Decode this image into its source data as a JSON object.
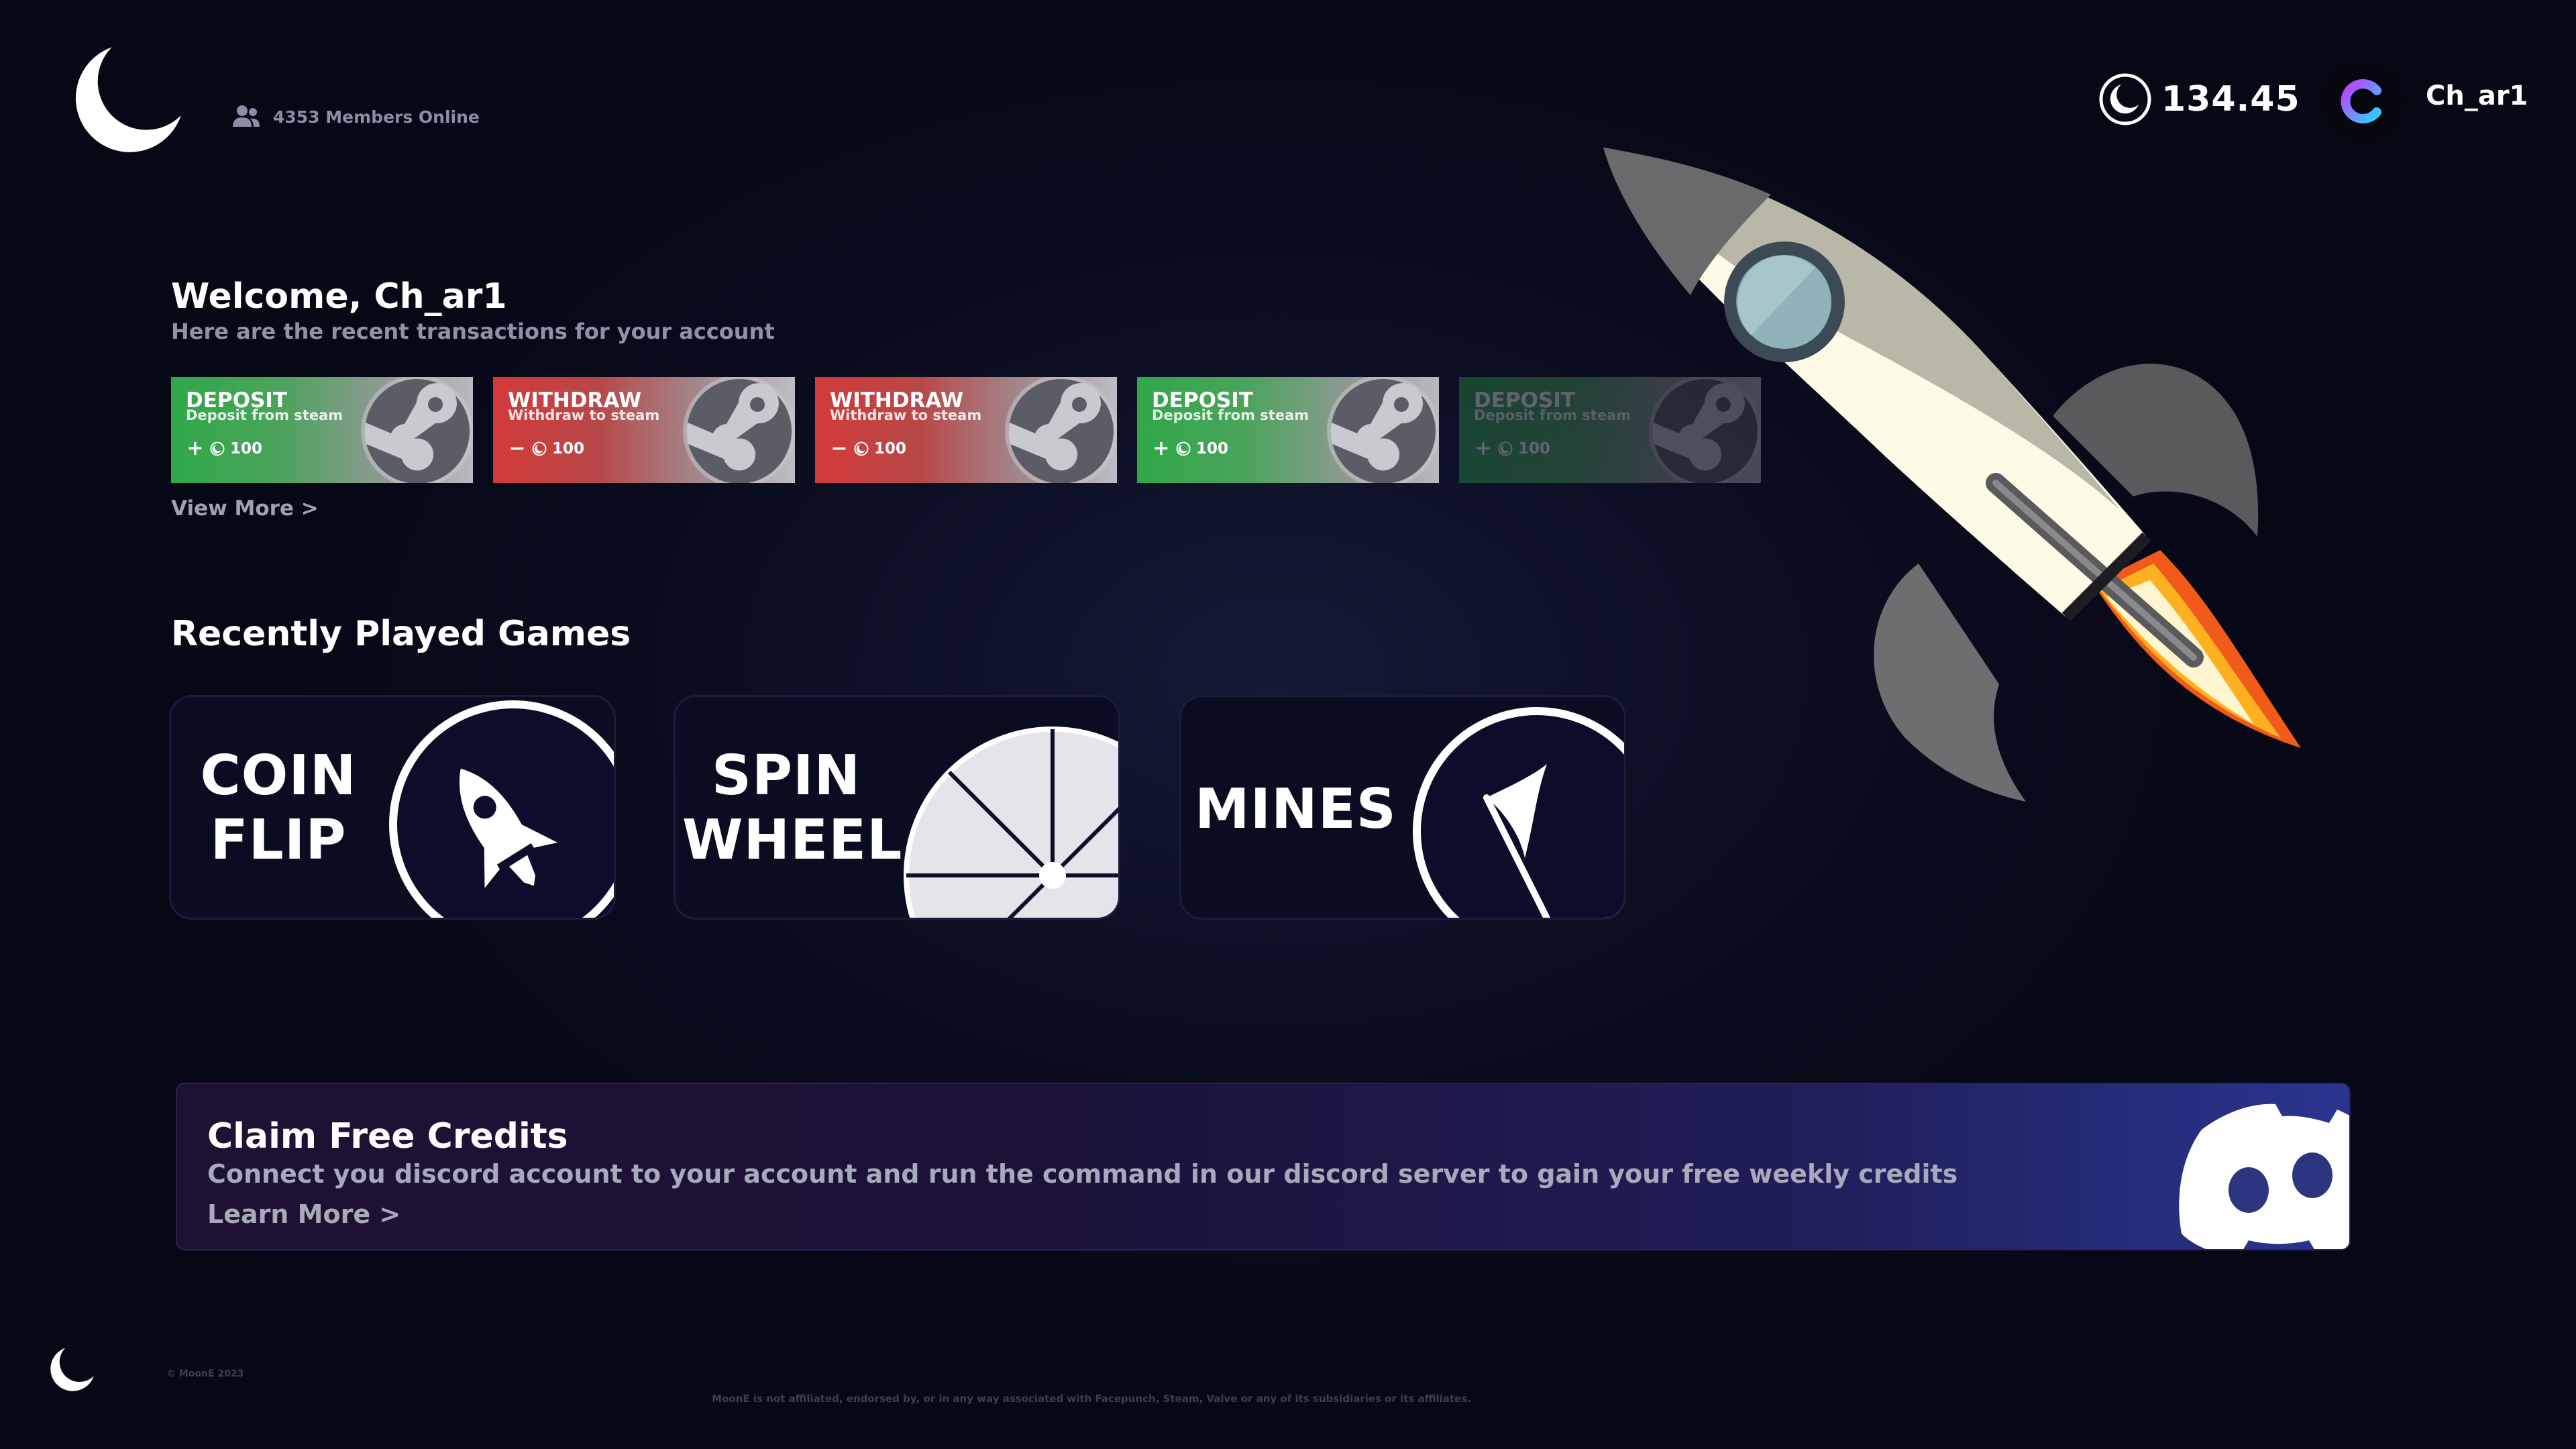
{
  "header": {
    "members_online": "4353 Members Online",
    "balance": "134.45",
    "username": "Ch_ar1"
  },
  "welcome": {
    "title": "Welcome, Ch_ar1",
    "subtitle": "Here are the recent transactions for your account"
  },
  "transactions": [
    {
      "type": "DEPOSIT",
      "description": "Deposit from steam",
      "sign": "+",
      "amount": "100",
      "kind": "deposit"
    },
    {
      "type": "WITHDRAW",
      "description": "Withdraw to steam",
      "sign": "−",
      "amount": "100",
      "kind": "withdraw"
    },
    {
      "type": "WITHDRAW",
      "description": "Withdraw to steam",
      "sign": "−",
      "amount": "100",
      "kind": "withdraw"
    },
    {
      "type": "DEPOSIT",
      "description": "Deposit from steam",
      "sign": "+",
      "amount": "100",
      "kind": "deposit"
    },
    {
      "type": "DEPOSIT",
      "description": "Deposit from steam",
      "sign": "+",
      "amount": "100",
      "kind": "deposit"
    }
  ],
  "view_more": "View More >",
  "games": {
    "title": "Recently Played Games",
    "items": [
      {
        "line1": "COIN",
        "line2": "FLIP",
        "icon": "rocket-icon"
      },
      {
        "line1": "SPIN",
        "line2": "WHEEL",
        "icon": "wheel-icon"
      },
      {
        "line1": "MINES",
        "line2": "",
        "icon": "flag-icon"
      }
    ]
  },
  "banner": {
    "title": "Claim Free Credits",
    "text": "Connect you discord account to your account and run the command in our discord server to gain your free weekly credits",
    "link": "Learn More >"
  },
  "footer": {
    "copyright": "© MoonE 2023",
    "disclaimer": "MoonE is not affiliated, endorsed by, or in any way associated with Facepunch, Steam, Valve or any of its subsidiaries or its affiliates."
  },
  "colors": {
    "background": "#0b0d20",
    "deposit": "#2fa84a",
    "withdraw": "#d23a3a",
    "card": "#0a0c21",
    "banner_end": "#2b3590"
  }
}
